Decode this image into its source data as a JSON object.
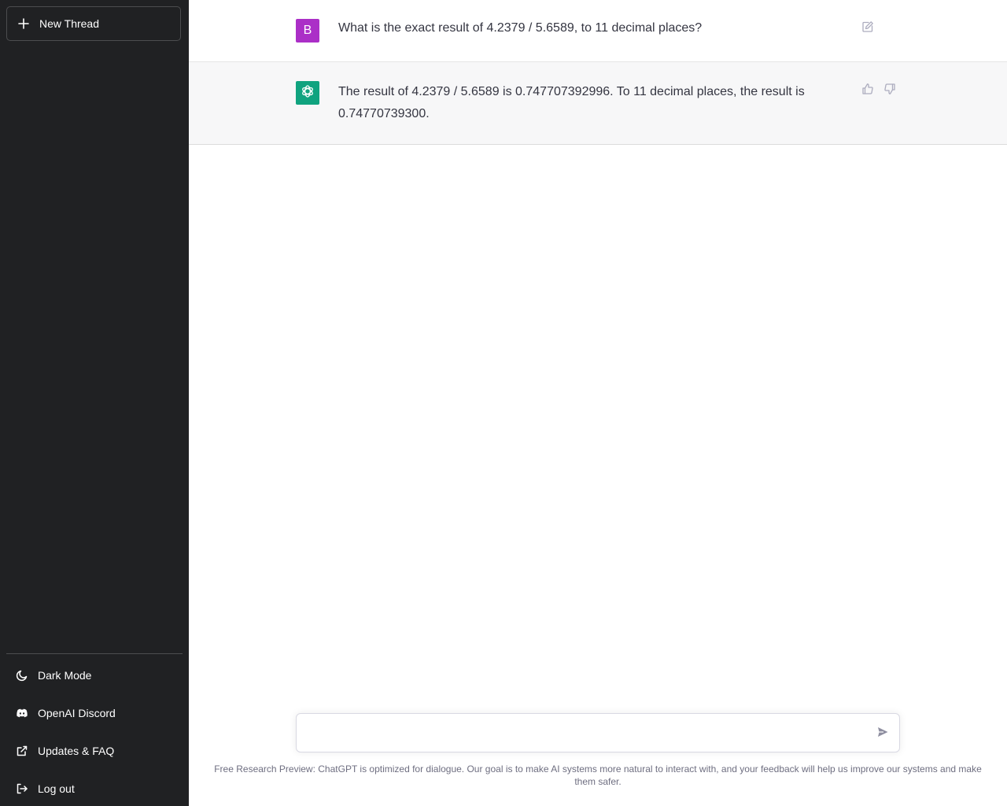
{
  "sidebar": {
    "new_thread_label": "New Thread",
    "items": [
      {
        "label": "Dark Mode",
        "icon": "moon-icon"
      },
      {
        "label": "OpenAI Discord",
        "icon": "discord-icon"
      },
      {
        "label": "Updates & FAQ",
        "icon": "external-link-icon"
      },
      {
        "label": "Log out",
        "icon": "logout-icon"
      }
    ]
  },
  "conversation": {
    "user": {
      "avatar_letter": "B",
      "text": "What is the exact result of 4.2379 / 5.6589, to 11 decimal places?"
    },
    "assistant": {
      "text": "The result of 4.2379 / 5.6589 is 0.747707392996. To 11 decimal places, the result is 0.74770739300."
    }
  },
  "composer": {
    "value": "",
    "placeholder": ""
  },
  "footer": {
    "note": "Free Research Preview: ChatGPT is optimized for dialogue. Our goal is to make AI systems more natural to interact with, and your feedback will help us improve our systems and make them safer."
  },
  "colors": {
    "sidebar_bg": "#202123",
    "user_avatar": "#ab2fc7",
    "assistant_avatar": "#10a37f",
    "assistant_row_bg": "#f7f7f8",
    "text": "#343541"
  }
}
